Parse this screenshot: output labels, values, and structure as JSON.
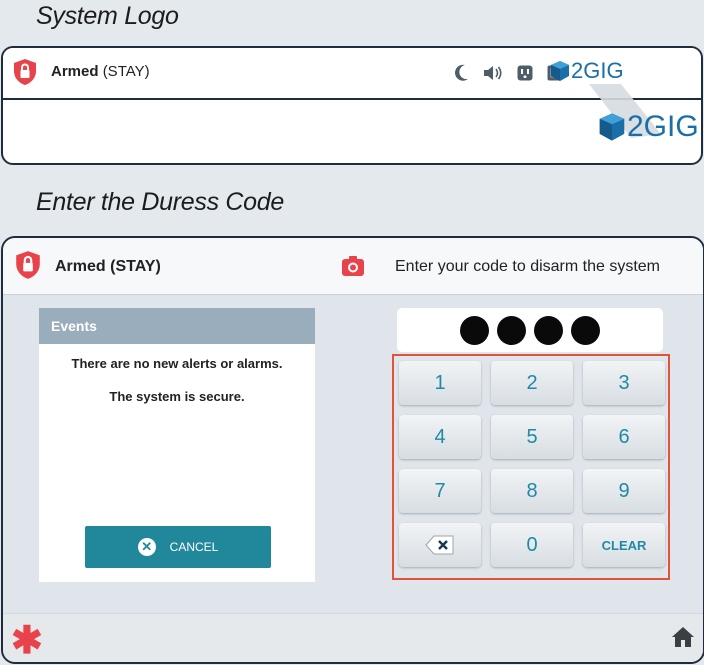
{
  "sections": {
    "logo_title": "System Logo",
    "duress_title": "Enter the Duress Code"
  },
  "panel1": {
    "status_bold": "Armed",
    "status_mode": "(STAY)",
    "status_icons": [
      "moon-icon",
      "speaker-icon",
      "outlet-icon",
      "sensor-icon"
    ],
    "logo_text_small": "2GIG",
    "logo_text_big": "2GIG"
  },
  "panel2": {
    "status": "Armed (STAY)",
    "prompt": "Enter your code to disarm the system",
    "events": {
      "header": "Events",
      "message1": "There are no new alerts or alarms.",
      "message2": "The system is secure.",
      "cancel_label": "CANCEL"
    },
    "code_entered_digits": 4,
    "keypad": {
      "keys": [
        "1",
        "2",
        "3",
        "4",
        "5",
        "6",
        "7",
        "8",
        "9",
        "⌫",
        "0",
        "CLEAR"
      ]
    },
    "footer": {
      "emergency_icon": "asterisk-icon",
      "home_icon": "home-icon"
    }
  },
  "colors": {
    "accent": "#21879b",
    "alert_red": "#e8434b",
    "highlight_border": "#e0533d",
    "logo_blue": "#1b6fa8",
    "events_header": "#9aadbd"
  }
}
